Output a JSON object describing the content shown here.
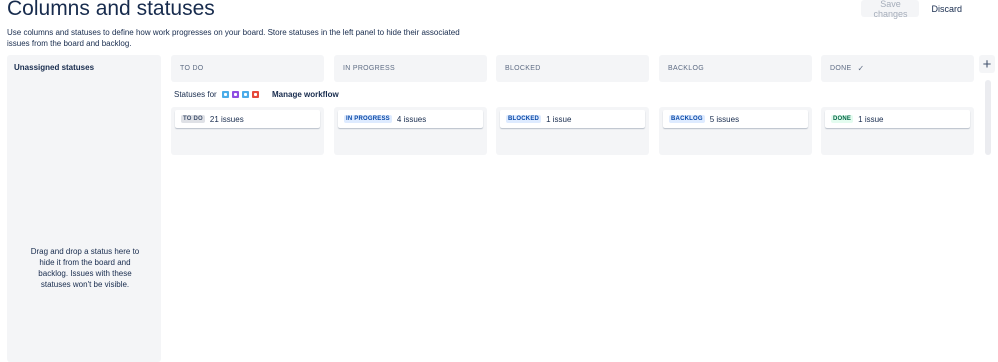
{
  "header": {
    "title": "Columns and statuses",
    "save_label": "Save changes",
    "discard_label": "Discard"
  },
  "description": "Use columns and statuses to define how work progresses on your board. Store statuses in the left panel to hide their associated issues from the board and backlog.",
  "unassigned": {
    "title": "Unassigned statuses",
    "help": "Drag and drop a status here to hide it from the board and backlog. Issues with these statuses won't be visible."
  },
  "workflow": {
    "statuses_for_label": "Statuses for",
    "issue_type_colors": [
      "#4bade8",
      "#904ee2",
      "#4bade8",
      "#e5493a"
    ],
    "manage_label": "Manage workflow"
  },
  "columns": [
    {
      "name": "TO DO",
      "status": "TO DO",
      "count": "21 issues"
    },
    {
      "name": "IN PROGRESS",
      "status": "IN PROGRESS",
      "count": "4 issues"
    },
    {
      "name": "BLOCKED",
      "status": "BLOCKED",
      "count": "1 issue"
    },
    {
      "name": "BACKLOG",
      "status": "BACKLOG",
      "count": "5 issues"
    },
    {
      "name": "DONE",
      "status": "DONE",
      "count": "1 issue"
    }
  ],
  "icons": {
    "done_check": "check-icon",
    "add_column": "plus-icon"
  }
}
